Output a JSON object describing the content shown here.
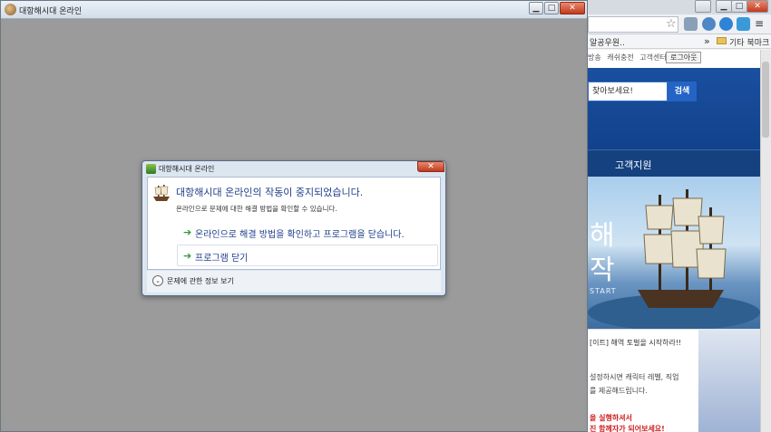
{
  "browser": {
    "bookmarks": {
      "left_item": "알공우원..",
      "more": "»",
      "other_bookmarks": "기타 북마크"
    },
    "page": {
      "top_links": [
        "방송",
        "캐쉬충전",
        "고객센터"
      ],
      "logout": "로그아웃",
      "search_placeholder": "찾아보세요!",
      "search_button": "검색",
      "nav_item": "고객지원",
      "banner_text1": "해",
      "banner_text2": "작",
      "banner_start": "START",
      "notice_title": "[이트] 해역 토벌을 시작하라!!",
      "notice_line1": "설정하시면 캐릭터 레벨, 직업",
      "notice_line2": "를 제공해드립니다.",
      "notice_red1": "을 실행하셔서",
      "notice_red2": "진 함께자가 되어보세요!"
    }
  },
  "game_window": {
    "title": "대항해시대 온라인",
    "minimize": "▁",
    "maximize": "□",
    "close": "✕"
  },
  "dialog": {
    "title": "대항해시대 온라인",
    "close": "✕",
    "heading": "대항해시대 온라인의 작동이 중지되었습니다.",
    "subtext": "온라인으로 문제에 대한 해결 방법을 확인할 수 있습니다.",
    "options": [
      {
        "arrow": "➔",
        "label": "온라인으로 해결 방법을 확인하고 프로그램을 닫습니다."
      },
      {
        "arrow": "➔",
        "label": "프로그램 닫기"
      }
    ],
    "details_toggle": "⌄",
    "details_label": "문제에 관한 정보 보기"
  }
}
